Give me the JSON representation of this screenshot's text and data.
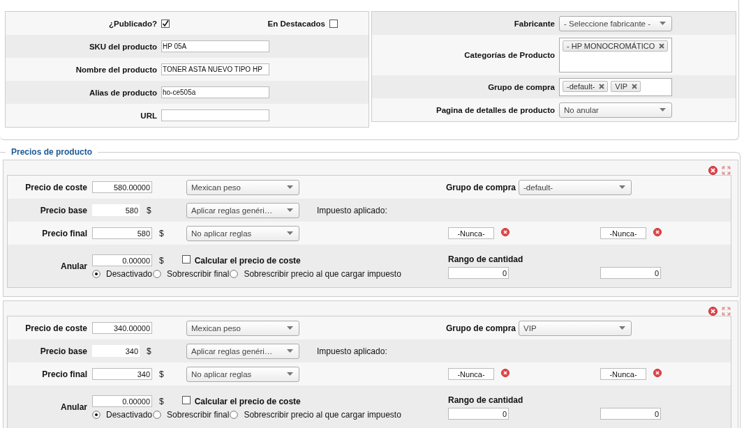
{
  "product_info": {
    "published": {
      "label": "¿Publicado?",
      "checked": true
    },
    "featured": {
      "label": "En Destacados",
      "checked": false
    },
    "fields": [
      {
        "label": "SKU del producto",
        "value": "HP 05A"
      },
      {
        "label": "Nombre del producto",
        "value": "TONER ASTA NUEVO TIPO HP"
      },
      {
        "label": "Alias de producto",
        "value": "ho-ce505a"
      },
      {
        "label": "URL"
      }
    ],
    "right": [
      {
        "kind": "select",
        "label": "Fabricante",
        "value": "- Seleccione fabricante -"
      },
      {
        "kind": "tag_area",
        "label": "Categorías de Producto",
        "tags": [
          "- HP MONOCROMÁTICO"
        ]
      },
      {
        "kind": "tag_field",
        "label": "Grupo de compra",
        "tags": [
          "-default-",
          "VIP"
        ]
      },
      {
        "kind": "select",
        "label": "Pagina de detalles de producto",
        "value": "No anular"
      }
    ]
  },
  "prices": {
    "title": "Precios de producto",
    "blocks": [
      {
        "cost": {
          "label": "Precio de coste",
          "value": "580.00000"
        },
        "currency": "Mexican peso",
        "shopper_group": {
          "label": "Grupo de compra",
          "value": "-default-"
        },
        "base": {
          "label": "Precio base",
          "value": "580",
          "unit": "$"
        },
        "base_rule": "Aplicar reglas genéri…",
        "tax_label": "Impuesto aplicado:",
        "final": {
          "label": "Precio final",
          "value": "580",
          "unit": "$"
        },
        "final_rule": "No aplicar reglas",
        "date_start": "-Nunca-",
        "date_end": "-Nunca-",
        "override": {
          "label": "Anular",
          "value": "0.00000",
          "unit": "$"
        },
        "calc_cost": {
          "label": "Calcular el precio de coste",
          "checked": false
        },
        "override_modes": [
          {
            "label": "Desactivado",
            "selected": true
          },
          {
            "label": "Sobrescribir final",
            "selected": false
          },
          {
            "label": "Sobrescribir precio al que cargar impuesto",
            "selected": false
          }
        ],
        "quantity": {
          "label": "Rango de cantidad",
          "start": "0",
          "end": "0"
        }
      },
      {
        "cost": {
          "label": "Precio de coste",
          "value": "340.00000"
        },
        "currency": "Mexican peso",
        "shopper_group": {
          "label": "Grupo de compra",
          "value": "VIP"
        },
        "base": {
          "label": "Precio base",
          "value": "340",
          "unit": "$"
        },
        "base_rule": "Aplicar reglas genéri…",
        "tax_label": "Impuesto aplicado:",
        "final": {
          "label": "Precio final",
          "value": "340",
          "unit": "$"
        },
        "final_rule": "No aplicar reglas",
        "date_start": "-Nunca-",
        "date_end": "-Nunca-",
        "override": {
          "label": "Anular",
          "value": "0.00000",
          "unit": "$"
        },
        "calc_cost": {
          "label": "Calcular el precio de coste",
          "checked": false
        },
        "override_modes": [
          {
            "label": "Desactivado",
            "selected": true
          },
          {
            "label": "Sobrescribir final",
            "selected": false
          },
          {
            "label": "Sobrescribir precio al que cargar impuesto",
            "selected": false
          }
        ],
        "quantity": {
          "label": "Rango de cantidad",
          "start": "0",
          "end": "0"
        }
      }
    ]
  }
}
